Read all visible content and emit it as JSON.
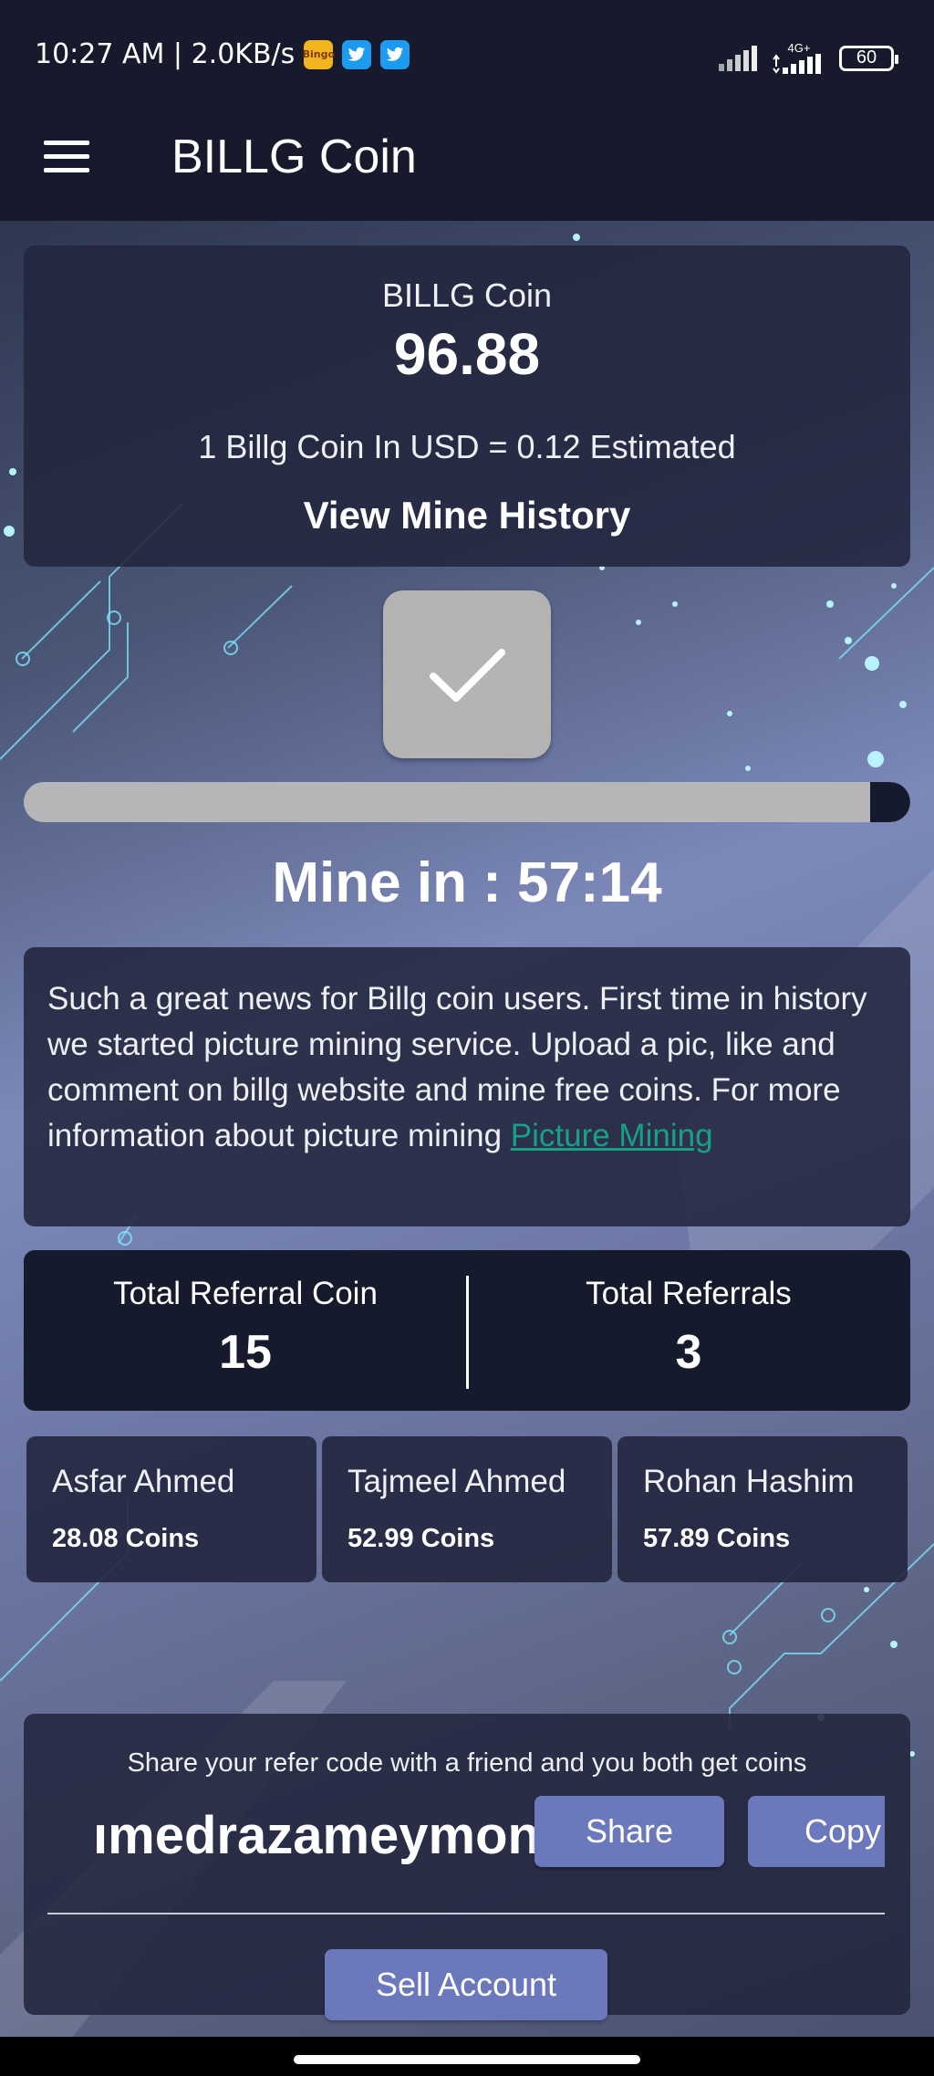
{
  "status_bar": {
    "time_speed": "10:27 AM | 2.0KB/s",
    "app_icons": [
      "bingo-icon",
      "twitter-icon",
      "twitter-icon"
    ],
    "bingo_label": "Bingo",
    "network": "4G+",
    "battery": "60"
  },
  "app_bar": {
    "title": "BILLG Coin",
    "menu_icon": "hamburger-menu-icon"
  },
  "balance": {
    "title": "BILLG Coin",
    "value": "96.88",
    "rate_text": "1 Billg Coin In USD = 0.12 Estimated",
    "history_link": "View Mine History"
  },
  "mine": {
    "check_icon": "checkmark-icon",
    "progress_fraction": 0.045,
    "timer": "Mine in : 57:14"
  },
  "news": {
    "text": "Such a great news for Billg coin users. First time in history we started picture mining service. Upload a pic, like and comment on billg website and mine free coins. For more information about picture mining ",
    "link_text": "Picture Mining"
  },
  "referrals": {
    "coin_label": "Total Referral Coin",
    "coin_value": "15",
    "count_label": "Total Referrals",
    "count_value": "3"
  },
  "users": [
    {
      "name": "Asfar Ahmed",
      "coins": "28.08 Coins"
    },
    {
      "name": "Tajmeel Ahmed",
      "coins": "52.99 Coins"
    },
    {
      "name": "Rohan Hashim",
      "coins": "57.89 Coins"
    }
  ],
  "share": {
    "text": "Share your refer code with a friend and you both get coins",
    "code_visible": "ımedrazameymon",
    "share_label": "Share",
    "copy_label": "Copy",
    "sell_label": "Sell Account"
  },
  "colors": {
    "header_bg": "#161a2c",
    "card_bg": "#22263e",
    "button_purple": "#6c78bc",
    "link_green": "#19a084"
  }
}
